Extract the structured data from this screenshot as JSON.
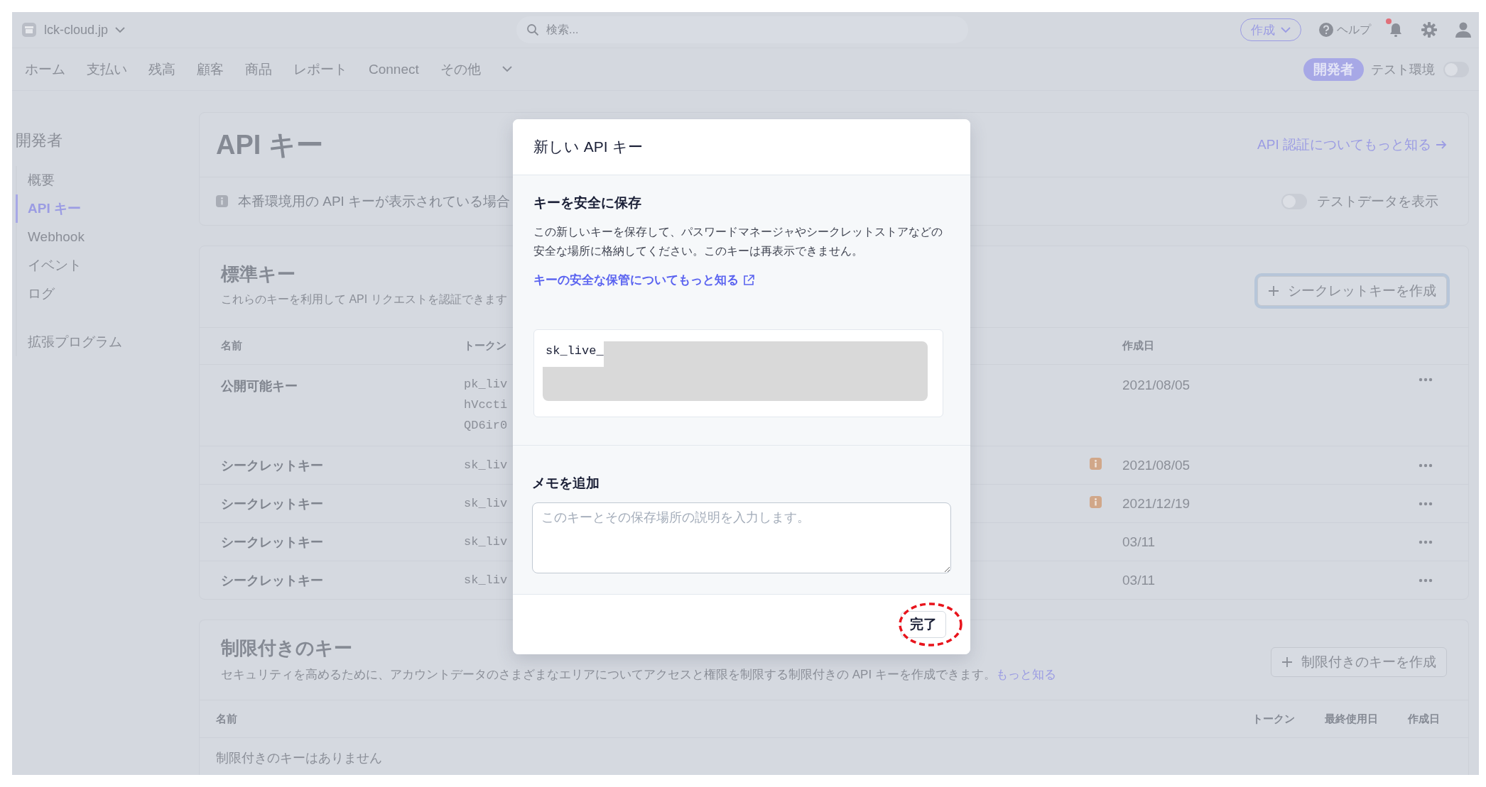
{
  "top_bar": {
    "account": "lck-cloud.jp",
    "search": {
      "placeholder": "検索..."
    },
    "create_button": "作成",
    "help": "ヘルプ",
    "notification_dot": true
  },
  "nav": {
    "items": [
      {
        "label": "ホーム",
        "selected": false
      },
      {
        "label": "支払い",
        "selected": false
      },
      {
        "label": "残高",
        "selected": false
      },
      {
        "label": "顧客",
        "selected": false
      },
      {
        "label": "商品",
        "selected": false
      },
      {
        "label": "レポート",
        "selected": false
      },
      {
        "label": "Connect",
        "selected": false
      }
    ],
    "more_menu": "その他",
    "developer_button": {
      "label": "開発者",
      "selected": true
    },
    "test_mode": {
      "label": "テスト環境",
      "on": false
    }
  },
  "sidebar": {
    "title": "開発者",
    "items": [
      {
        "label": "概要",
        "selected": false
      },
      {
        "label": "API キー",
        "selected": true
      },
      {
        "label": "Webhook",
        "selected": false
      },
      {
        "label": "イベント",
        "selected": false
      },
      {
        "label": "ログ",
        "selected": false
      }
    ],
    "extra_items": [
      {
        "label": "拡張プログラム",
        "selected": false
      }
    ]
  },
  "header_card": {
    "title": "API キー",
    "doc_link": "API 認証についてもっと知る",
    "notice": "本番環境用の API キーが表示されている場合",
    "test_data_toggle": {
      "label": "テストデータを表示",
      "on": false
    }
  },
  "standard_keys": {
    "title": "標準キー",
    "description": "これらのキーを利用して API リクエストを認証できます",
    "create_button": {
      "label": "シークレットキーを作成",
      "focused": true
    },
    "columns": [
      "名前",
      "トークン",
      "作成日"
    ],
    "rows": [
      {
        "name": "公開可能キー",
        "token": [
          "pk_liv",
          "hVccti",
          "QD6ir0"
        ],
        "warning": false,
        "created": "2021/08/05"
      },
      {
        "name": "シークレットキー",
        "token": [
          "sk_liv"
        ],
        "warning": true,
        "created": "2021/08/05"
      },
      {
        "name": "シークレットキー",
        "token": [
          "sk_liv"
        ],
        "warning": true,
        "created": "2021/12/19"
      },
      {
        "name": "シークレットキー",
        "token": [
          "sk_liv"
        ],
        "warning": false,
        "created": "03/11"
      },
      {
        "name": "シークレットキー",
        "token": [
          "sk_liv"
        ],
        "warning": false,
        "created": "03/11"
      }
    ]
  },
  "restricted_keys": {
    "title": "制限付きのキー",
    "description": "セキュリティを高めるために、アカウントデータのさまざまなエリアについてアクセスと権限を制限する制限付きの API キーを作成できます。",
    "description_link": "もっと知る",
    "create_button": "制限付きのキーを作成",
    "columns": [
      "名前",
      "トークン",
      "最終使用日",
      "作成日"
    ],
    "empty_text": "制限付きのキーはありません"
  },
  "dialog": {
    "title": "新しい API キー",
    "section_title": "キーを安全に保存",
    "body": "この新しいキーを保存して、パスワードマネージャやシークレットストアなどの安全な場所に格納してください。このキーは再表示できません。",
    "link": "キーの安全な保管についてもっと知る",
    "key_prefix": "sk_live_",
    "memo_label": "メモを追加",
    "memo": {
      "placeholder": "このキーとその保存場所の説明を入力します。"
    },
    "done_button": "完了",
    "done_highlighted": true
  }
}
